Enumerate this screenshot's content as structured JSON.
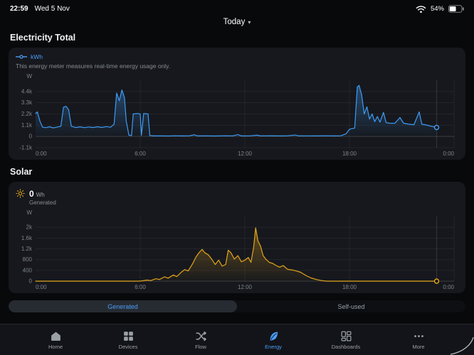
{
  "status_bar": {
    "time": "22:59",
    "date": "Wed 5 Nov",
    "battery_percent": "54%"
  },
  "header": {
    "date_selector_label": "Today"
  },
  "sections": {
    "electricity": {
      "title": "Electricity Total",
      "legend_label": "kWh",
      "note": "This energy meter measures real-time energy usage only."
    },
    "solar": {
      "title": "Solar",
      "generated_value": "0",
      "generated_unit": "Wh",
      "generated_label": "Generated",
      "tab_generated": "Generated",
      "tab_self_used": "Self-used"
    }
  },
  "tab_bar": {
    "items": [
      {
        "label": "Home",
        "icon": "home-icon",
        "active": false
      },
      {
        "label": "Devices",
        "icon": "devices-grid-icon",
        "active": false
      },
      {
        "label": "Flow",
        "icon": "flow-arrows-icon",
        "active": false
      },
      {
        "label": "Energy",
        "icon": "energy-leaf-icon",
        "active": true
      },
      {
        "label": "Dashboards",
        "icon": "dashboards-icon",
        "active": false
      },
      {
        "label": "More",
        "icon": "more-dots-icon",
        "active": false
      }
    ]
  },
  "colors": {
    "electricity_line": "#3f9bf5",
    "solar_line": "#e3a41c",
    "accent_blue": "#4a9df8",
    "card_bg": "#16181d",
    "page_bg": "#08090b"
  },
  "chart_data": [
    {
      "id": "electricity",
      "type": "area",
      "title": "Electricity Total",
      "y_unit": "W",
      "xlim": [
        0,
        24
      ],
      "ylim": [
        -1100,
        5500
      ],
      "x_ticks": {
        "values": [
          0,
          6,
          12,
          18,
          24
        ],
        "labels": [
          "0:00",
          "6:00",
          "12:00",
          "18:00",
          "0:00"
        ]
      },
      "y_ticks": {
        "values": [
          -1100,
          0,
          1100,
          2200,
          3300,
          4400
        ],
        "labels": [
          "-1.1k",
          "0",
          "1.1k",
          "2.2k",
          "3.3k",
          "4.4k"
        ]
      },
      "legend_position": "top-left",
      "grid": true,
      "end_marker": true,
      "series": [
        {
          "name": "kWh",
          "color": "#3f9bf5",
          "points": [
            [
              0,
              2250
            ],
            [
              0.1,
              2400
            ],
            [
              0.25,
              1500
            ],
            [
              0.4,
              900
            ],
            [
              0.6,
              860
            ],
            [
              0.8,
              950
            ],
            [
              1,
              840
            ],
            [
              1.2,
              900
            ],
            [
              1.45,
              1000
            ],
            [
              1.6,
              2850
            ],
            [
              1.75,
              2950
            ],
            [
              1.9,
              2600
            ],
            [
              2.05,
              1000
            ],
            [
              2.3,
              870
            ],
            [
              2.55,
              940
            ],
            [
              2.8,
              860
            ],
            [
              3.05,
              930
            ],
            [
              3.3,
              870
            ],
            [
              3.55,
              950
            ],
            [
              3.8,
              880
            ],
            [
              4.05,
              960
            ],
            [
              4.3,
              900
            ],
            [
              4.5,
              1200
            ],
            [
              4.65,
              4250
            ],
            [
              4.8,
              3500
            ],
            [
              4.95,
              4550
            ],
            [
              5.1,
              3800
            ],
            [
              5.2,
              1500
            ],
            [
              5.35,
              120
            ],
            [
              5.5,
              80
            ],
            [
              5.6,
              2200
            ],
            [
              5.85,
              2250
            ],
            [
              6,
              2200
            ],
            [
              6.07,
              100
            ],
            [
              6.2,
              2250
            ],
            [
              6.45,
              2200
            ],
            [
              6.55,
              90
            ],
            [
              6.8,
              50
            ],
            [
              7.2,
              60
            ],
            [
              7.6,
              45
            ],
            [
              8,
              70
            ],
            [
              8.4,
              50
            ],
            [
              8.8,
              60
            ],
            [
              9.1,
              160
            ],
            [
              9.3,
              50
            ],
            [
              9.8,
              60
            ],
            [
              10.3,
              45
            ],
            [
              10.8,
              70
            ],
            [
              11.3,
              50
            ],
            [
              11.6,
              180
            ],
            [
              11.8,
              55
            ],
            [
              12.3,
              60
            ],
            [
              12.7,
              120
            ],
            [
              12.9,
              50
            ],
            [
              13.4,
              65
            ],
            [
              13.9,
              50
            ],
            [
              14.4,
              60
            ],
            [
              14.9,
              140
            ],
            [
              15.1,
              50
            ],
            [
              15.6,
              60
            ],
            [
              16.1,
              50
            ],
            [
              16.6,
              65
            ],
            [
              17.1,
              50
            ],
            [
              17.5,
              60
            ],
            [
              17.8,
              250
            ],
            [
              18,
              700
            ],
            [
              18.15,
              760
            ],
            [
              18.3,
              820
            ],
            [
              18.45,
              4850
            ],
            [
              18.55,
              5000
            ],
            [
              18.7,
              4100
            ],
            [
              18.85,
              2200
            ],
            [
              19,
              2900
            ],
            [
              19.15,
              1700
            ],
            [
              19.3,
              2200
            ],
            [
              19.45,
              1450
            ],
            [
              19.6,
              1950
            ],
            [
              19.75,
              1400
            ],
            [
              19.95,
              2350
            ],
            [
              20.1,
              1350
            ],
            [
              20.3,
              1300
            ],
            [
              20.6,
              1280
            ],
            [
              20.9,
              1850
            ],
            [
              21.1,
              1300
            ],
            [
              21.4,
              1200
            ],
            [
              21.7,
              1150
            ],
            [
              22,
              2400
            ],
            [
              22.15,
              1200
            ],
            [
              22.4,
              1120
            ],
            [
              22.7,
              1000
            ],
            [
              23,
              880
            ]
          ]
        }
      ]
    },
    {
      "id": "solar",
      "type": "area",
      "title": "Solar — Generated",
      "y_unit": "W",
      "xlim": [
        0,
        24
      ],
      "ylim": [
        0,
        2400
      ],
      "x_ticks": {
        "values": [
          0,
          6,
          12,
          18,
          24
        ],
        "labels": [
          "0:00",
          "6:00",
          "12:00",
          "18:00",
          "0:00"
        ]
      },
      "y_ticks": {
        "values": [
          0,
          400,
          800,
          1200,
          1600,
          2000
        ],
        "labels": [
          "0",
          "400",
          "800",
          "1.2k",
          "1.6k",
          "2k"
        ]
      },
      "grid": true,
      "end_marker": true,
      "series": [
        {
          "name": "Generated",
          "color": "#e3a41c",
          "points": [
            [
              0,
              0
            ],
            [
              5.9,
              0
            ],
            [
              6.1,
              10
            ],
            [
              6.4,
              40
            ],
            [
              6.6,
              20
            ],
            [
              6.9,
              90
            ],
            [
              7.1,
              60
            ],
            [
              7.4,
              160
            ],
            [
              7.6,
              110
            ],
            [
              7.9,
              230
            ],
            [
              8.1,
              170
            ],
            [
              8.35,
              330
            ],
            [
              8.55,
              430
            ],
            [
              8.75,
              380
            ],
            [
              9,
              640
            ],
            [
              9.2,
              900
            ],
            [
              9.4,
              1080
            ],
            [
              9.55,
              1180
            ],
            [
              9.7,
              1060
            ],
            [
              9.9,
              980
            ],
            [
              10.1,
              820
            ],
            [
              10.3,
              620
            ],
            [
              10.5,
              780
            ],
            [
              10.7,
              560
            ],
            [
              10.9,
              620
            ],
            [
              11.05,
              1150
            ],
            [
              11.2,
              1060
            ],
            [
              11.4,
              820
            ],
            [
              11.6,
              950
            ],
            [
              11.8,
              720
            ],
            [
              12,
              780
            ],
            [
              12.2,
              880
            ],
            [
              12.35,
              700
            ],
            [
              12.5,
              1250
            ],
            [
              12.62,
              1980
            ],
            [
              12.75,
              1500
            ],
            [
              12.9,
              1300
            ],
            [
              13.05,
              950
            ],
            [
              13.2,
              820
            ],
            [
              13.4,
              700
            ],
            [
              13.6,
              660
            ],
            [
              13.8,
              580
            ],
            [
              14,
              520
            ],
            [
              14.2,
              580
            ],
            [
              14.45,
              440
            ],
            [
              14.7,
              420
            ],
            [
              14.95,
              380
            ],
            [
              15.2,
              330
            ],
            [
              15.5,
              210
            ],
            [
              15.8,
              120
            ],
            [
              16.1,
              60
            ],
            [
              16.4,
              20
            ],
            [
              16.7,
              0
            ],
            [
              23,
              0
            ]
          ]
        }
      ]
    }
  ]
}
